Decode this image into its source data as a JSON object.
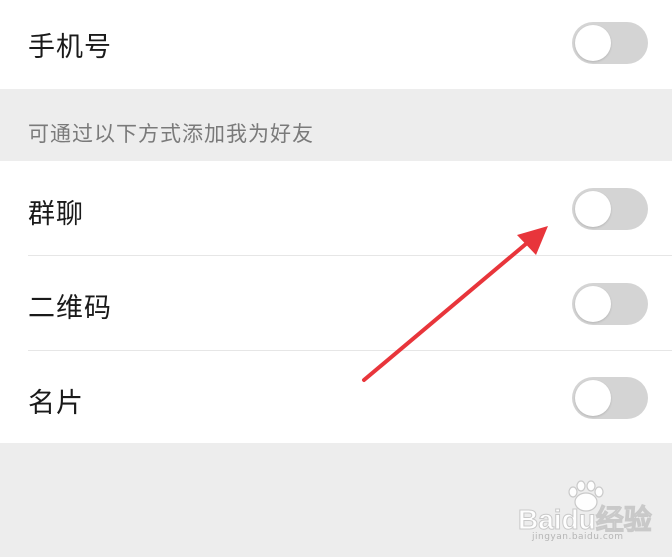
{
  "phone_row": {
    "label": "手机号",
    "enabled": false
  },
  "add_me_section": {
    "header": "可通过以下方式添加我为好友",
    "items": [
      {
        "label": "群聊",
        "enabled": false
      },
      {
        "label": "二维码",
        "enabled": false
      },
      {
        "label": "名片",
        "enabled": false
      }
    ]
  },
  "watermark": {
    "text": "Baidu经验",
    "sub": "jingyan.baidu.com"
  },
  "colors": {
    "page_bg": "#ededed",
    "row_bg": "#ffffff",
    "toggle_off": "#d4d4d4",
    "arrow": "#e8353b"
  },
  "icons": {
    "annotation": "red-arrow-icon",
    "logo": "baidu-paw-icon"
  }
}
